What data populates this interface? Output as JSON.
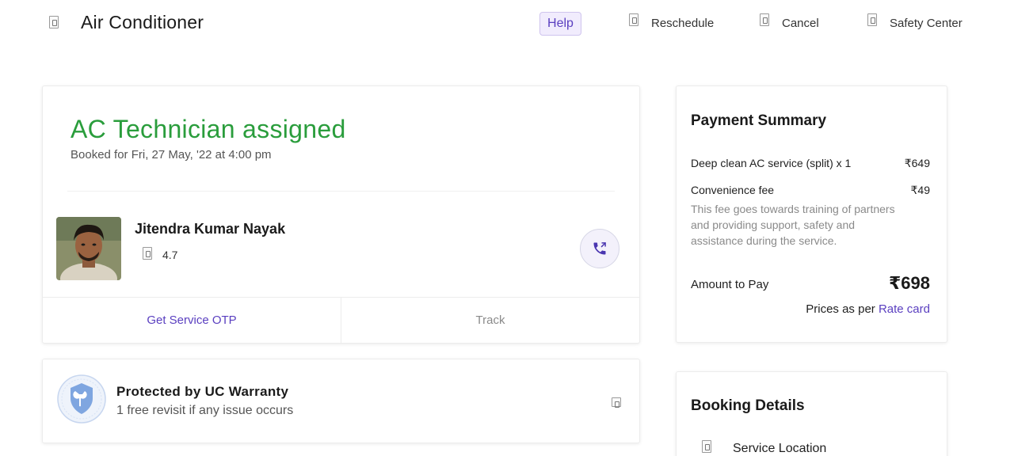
{
  "header": {
    "title": "Air Conditioner",
    "help_label": "Help",
    "reschedule_label": "Reschedule",
    "cancel_label": "Cancel",
    "safety_label": "Safety Center"
  },
  "status": {
    "title": "AC Technician assigned",
    "booked_for": "Booked for Fri, 27 May, '22 at 4:00 pm"
  },
  "technician": {
    "name": "Jitendra Kumar Nayak",
    "rating": "4.7"
  },
  "actions": {
    "otp_label": "Get Service OTP",
    "track_label": "Track"
  },
  "warranty": {
    "title": "Protected by UC Warranty",
    "subtitle": "1 free revisit if any issue occurs"
  },
  "payment": {
    "title": "Payment Summary",
    "service_label": "Deep clean AC service (split) x 1",
    "service_price": "₹649",
    "fee_label": "Convenience fee",
    "fee_price": "₹49",
    "fee_note": "This fee goes towards training of partners and providing support, safety and assistance during the service.",
    "amount_label": "Amount to Pay",
    "amount_value": "₹698",
    "prices_as_per": "Prices as per",
    "rate_card_label": "Rate card"
  },
  "booking": {
    "title": "Booking Details",
    "service_location_label": "Service Location"
  },
  "colors": {
    "status_green": "#2a9d3c",
    "accent_purple": "#5a3fc0"
  },
  "icons": [
    "back-icon",
    "reschedule-icon",
    "cancel-icon",
    "safety-center-icon",
    "star-icon",
    "phone-icon",
    "warranty-shield-icon",
    "chevron-right-icon",
    "location-icon"
  ]
}
